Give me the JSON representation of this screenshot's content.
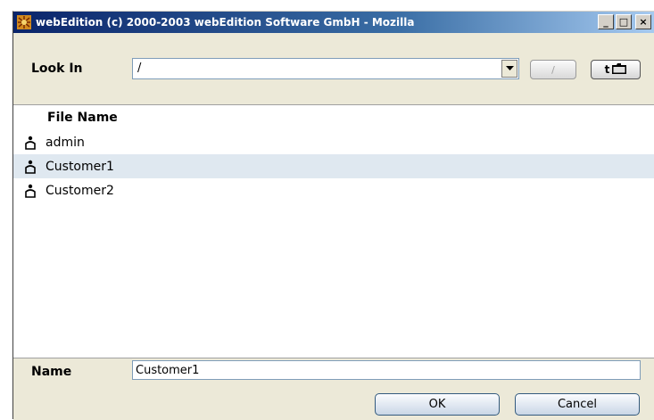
{
  "window": {
    "title": "webEdition (c) 2000-2003 webEdition Software GmbH - Mozilla",
    "minimize_label": "_",
    "maximize_label": "□",
    "close_label": "×"
  },
  "look_in": {
    "label": "Look In",
    "value": "/",
    "root_button_label": "/",
    "up_button_label": "t"
  },
  "file_list": {
    "column_header": "File Name",
    "items": [
      {
        "label": "admin",
        "icon": "user-icon",
        "selected": false
      },
      {
        "label": "Customer1",
        "icon": "user-icon",
        "selected": true
      },
      {
        "label": "Customer2",
        "icon": "user-icon",
        "selected": false
      }
    ]
  },
  "name_field": {
    "label": "Name",
    "value": "Customer1"
  },
  "buttons": {
    "ok": "OK",
    "cancel": "Cancel"
  },
  "colors": {
    "titlebar": "#0a246a",
    "selection": "#dfe8f0",
    "dialog_bg": "#ece9d8"
  }
}
